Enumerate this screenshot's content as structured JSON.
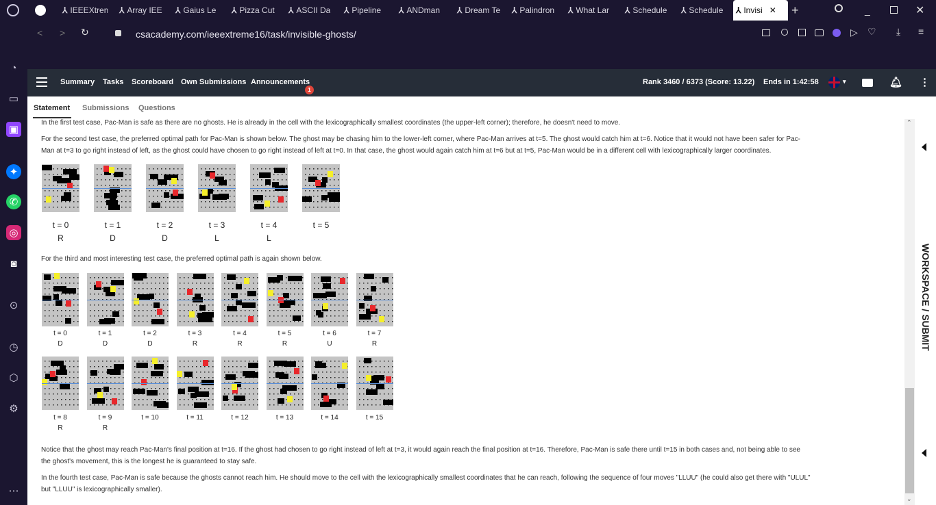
{
  "browser": {
    "tabs": [
      {
        "label": "IEEEXtrem"
      },
      {
        "label": "Array IEE"
      },
      {
        "label": "Gaius Le"
      },
      {
        "label": "Pizza Cut"
      },
      {
        "label": "ASCII Da"
      },
      {
        "label": "Pipeline"
      },
      {
        "label": "ANDman"
      },
      {
        "label": "Dream Te"
      },
      {
        "label": "Palindron"
      },
      {
        "label": "What Lar"
      },
      {
        "label": "Schedule"
      },
      {
        "label": "Schedule"
      },
      {
        "label": "Invisi"
      }
    ],
    "url": "csacademy.com/ieeextreme16/task/invisible-ghosts/"
  },
  "nav": {
    "items": [
      "Summary",
      "Tasks",
      "Scoreboard",
      "Own Submissions",
      "Announcements"
    ],
    "badge": "1",
    "rank": "Rank 3460 / 6373 (Score: 13.22)",
    "ends": "Ends in 1:42:58"
  },
  "subtabs": [
    "Statement",
    "Submissions",
    "Questions"
  ],
  "para1": "In the first test case, Pac-Man is safe as there are no ghosts. He is already in the cell with the lexicographically smallest coordinates (the upper-left corner); therefore, he doesn't need to move.",
  "para2a": "For the second test case, the preferred optimal path for Pac-Man is shown below. The ghost may be chasing him to the lower-left corner, where Pac-Man arrives at t=5. The ghost would catch him at t=6. Notice that it would not have been safer for Pac-",
  "para2b": "Man at t=3 to go right instead of left, as the ghost could have chosen to go right instead of left at t=0. In that case, the ghost would again catch him at t=6 but at t=5, Pac-Man would be in a different cell with lexicographically larger coordinates.",
  "row1": [
    {
      "t": "t = 0",
      "m": "R"
    },
    {
      "t": "t = 1",
      "m": "D"
    },
    {
      "t": "t = 2",
      "m": "D"
    },
    {
      "t": "t = 3",
      "m": "L"
    },
    {
      "t": "t = 4",
      "m": "L"
    },
    {
      "t": "t = 5",
      "m": ""
    }
  ],
  "para3": "For the third and most interesting test case, the preferred optimal path is again shown below.",
  "row2": [
    {
      "t": "t = 0",
      "m": "D"
    },
    {
      "t": "t = 1",
      "m": "D"
    },
    {
      "t": "t = 2",
      "m": "D"
    },
    {
      "t": "t = 3",
      "m": "R"
    },
    {
      "t": "t = 4",
      "m": "R"
    },
    {
      "t": "t = 5",
      "m": "R"
    },
    {
      "t": "t = 6",
      "m": "U"
    },
    {
      "t": "t = 7",
      "m": "R"
    }
  ],
  "row3": [
    {
      "t": "t = 8",
      "m": "R"
    },
    {
      "t": "t = 9",
      "m": "R"
    },
    {
      "t": "t = 10",
      "m": ""
    },
    {
      "t": "t = 11",
      "m": ""
    },
    {
      "t": "t = 12",
      "m": ""
    },
    {
      "t": "t = 13",
      "m": ""
    },
    {
      "t": "t = 14",
      "m": ""
    },
    {
      "t": "t = 15",
      "m": ""
    }
  ],
  "para4a": "Notice that the ghost may reach Pac-Man's final position at t=16. If the ghost had chosen to go right instead of left at t=3, it would again reach the final position at t=16. Therefore, Pac-Man is safe there until t=15 in both cases and, not being able to see",
  "para4b": "the ghost's movement, this is the longest he is guaranteed to stay safe.",
  "para5a": "In the fourth test case, Pac-Man is safe because the ghosts cannot reach him. He should move to the cell with the lexicographically smallest coordinates that he can reach, following the sequence of four moves \"LLUU\" (he could also get there with \"ULUL\"",
  "para5b": "but \"LLUU\" is lexicographically smaller).",
  "workspace": "WORKSPACE / SUBMIT",
  "colors": {
    "bg": "#1b1630",
    "nav": "#262d38",
    "badge": "#e0453a",
    "ghost": "#e8282c",
    "pac": "#f5ef2a",
    "wall": "#000000"
  }
}
